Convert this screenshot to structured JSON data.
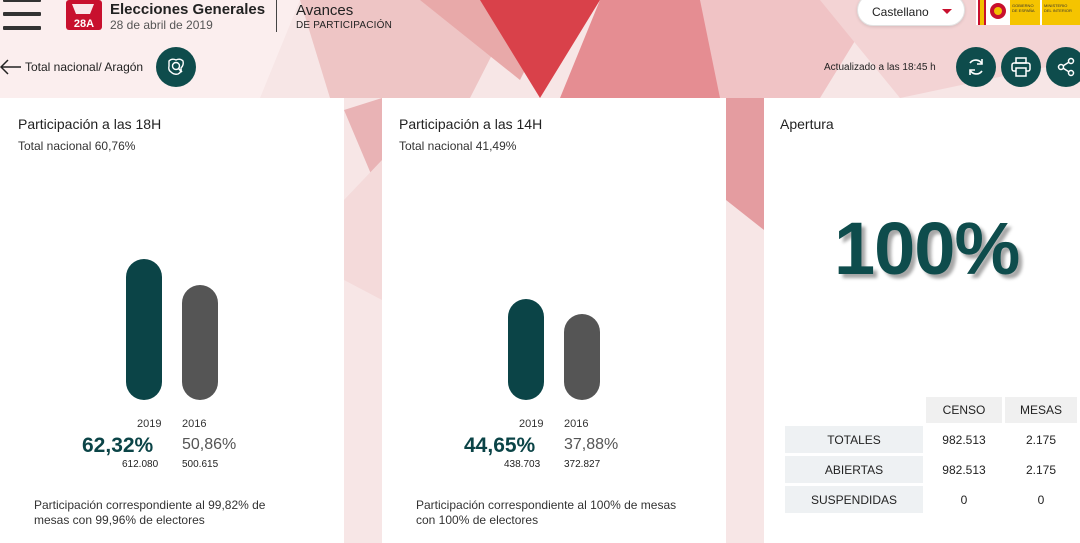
{
  "header": {
    "logo_text": "28A",
    "title": "Elecciones Generales",
    "date": "28 de abril de 2019",
    "section_line1": "Avances",
    "section_line2": "DE PARTICIPACIÓN",
    "language": "Castellano",
    "gov_logo_text": "GOBIERNO DE ESPAÑA · MINISTERIO DEL INTERIOR"
  },
  "nav": {
    "breadcrumb": "Total nacional/ Aragón",
    "updated": "Actualizado a las 18:45 h"
  },
  "icons": {
    "menu": "hamburger-menu-icon",
    "back": "arrow-left-icon",
    "map": "map-search-icon",
    "refresh": "refresh-icon",
    "print": "print-icon",
    "share": "share-icon"
  },
  "colors": {
    "accent_dark": "#0b4447",
    "bar_2016": "#555555",
    "brand_red": "#c8102e"
  },
  "cards": [
    {
      "title": "Participación a las 18H",
      "subtitle": "Total nacional 60,76%",
      "year_a": "2019",
      "year_b": "2016",
      "pct_a": "62,32%",
      "pct_b": "50,86%",
      "count_a": "612.080",
      "count_b": "500.615",
      "note": "Participación correspondiente al 99,82% de mesas con 99,96% de electores"
    },
    {
      "title": "Participación a las 14H",
      "subtitle": "Total nacional 41,49%",
      "year_a": "2019",
      "year_b": "2016",
      "pct_a": "44,65%",
      "pct_b": "37,88%",
      "count_a": "438.703",
      "count_b": "372.827",
      "note": "Participación correspondiente al 100% de mesas con 100% de electores"
    }
  ],
  "chart_data": [
    {
      "type": "bar",
      "title": "Participación a las 18H",
      "categories": [
        "2019",
        "2016"
      ],
      "values": [
        62.32,
        50.86
      ]
    },
    {
      "type": "bar",
      "title": "Participación a las 14H",
      "categories": [
        "2019",
        "2016"
      ],
      "values": [
        44.65,
        37.88
      ]
    }
  ],
  "apertura": {
    "title": "Apertura",
    "value": "100%",
    "columns": [
      "CENSO",
      "MESAS"
    ],
    "rows": [
      {
        "label": "TOTALES",
        "censo": "982.513",
        "mesas": "2.175"
      },
      {
        "label": "ABIERTAS",
        "censo": "982.513",
        "mesas": "2.175"
      },
      {
        "label": "SUSPENDIDAS",
        "censo": "0",
        "mesas": "0"
      }
    ]
  }
}
